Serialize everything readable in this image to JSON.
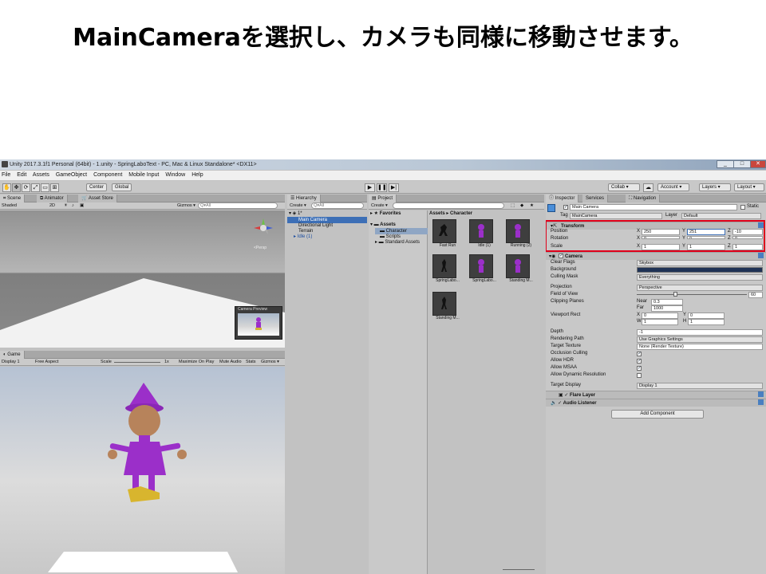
{
  "heading": "MainCameraを選択し、カメラも同様に移動させます。",
  "window": {
    "title": "Unity 2017.3.1f1 Personal (64bit) - 1.unity - SpringLaboText - PC, Mac & Linux Standalone* <DX11>",
    "controls": [
      "_",
      "□",
      "✕"
    ]
  },
  "menu": [
    "File",
    "Edit",
    "Assets",
    "GameObject",
    "Component",
    "Mobile Input",
    "Window",
    "Help"
  ],
  "toolbar": {
    "center": "Center",
    "global": "Global",
    "collab": "Collab ▾",
    "account": "Account ▾",
    "layers": "Layers ▾",
    "layout": "Layout ▾"
  },
  "scene": {
    "tabs": [
      "Scene",
      "Animator",
      "Asset Store"
    ],
    "shaded": "Shaded",
    "mode2d": "2D",
    "gizmos": "Gizmos ▾",
    "search_placeholder": "Q▾All",
    "persp": "<Persp",
    "camera_preview": "Camera Preview"
  },
  "game": {
    "tab": "Game",
    "display": "Display 1",
    "aspect": "Free Aspect",
    "scale_label": "Scale",
    "scale_value": "1x",
    "maximize": "Maximize On Play",
    "mute": "Mute Audio",
    "stats": "Stats",
    "gizmos": "Gizmos ▾"
  },
  "hierarchy": {
    "tab": "Hierarchy",
    "create": "Create ▾",
    "search_placeholder": "Q▾All",
    "scene": "1*",
    "items": [
      "Main Camera",
      "Directional Light",
      "Terrain",
      "Idle (1)"
    ]
  },
  "project": {
    "tab": "Project",
    "create": "Create ▾",
    "favorites": "Favorites",
    "assets": "Assets",
    "folders": [
      "Character",
      "Scripts",
      "Standard Assets"
    ],
    "breadcrumb": "Assets ▸ Character",
    "thumbs": [
      "Fast Run",
      "Idle (1)",
      "Running (2)",
      "SpringLabo...",
      "SpringLabo...",
      "Standing M...",
      "Standing M..."
    ]
  },
  "inspector": {
    "tabs": [
      "Inspector",
      "Services",
      "Navigation"
    ],
    "object_name": "Main Camera",
    "static_label": "Static",
    "tag_label": "Tag",
    "tag_value": "MainCamera",
    "layer_label": "Layer",
    "layer_value": "Default",
    "transform": {
      "title": "Transform",
      "position_label": "Position",
      "rotation_label": "Rotation",
      "scale_label": "Scale",
      "position": {
        "x": "250",
        "y": "251",
        "z": "-10"
      },
      "rotation": {
        "x": "0",
        "y": "0",
        "z": "0"
      },
      "scale": {
        "x": "1",
        "y": "1",
        "z": "1"
      }
    },
    "camera": {
      "title": "Camera",
      "rows": [
        {
          "label": "Clear Flags",
          "value": "Skybox"
        },
        {
          "label": "Background",
          "value": ""
        },
        {
          "label": "Culling Mask",
          "value": "Everything"
        },
        {
          "label": "Projection",
          "value": "Perspective"
        },
        {
          "label": "Field of View",
          "value": "60"
        },
        {
          "label": "Clipping Planes",
          "value": ""
        },
        {
          "label": "Viewport Rect",
          "value": ""
        },
        {
          "label": "Depth",
          "value": "-1"
        },
        {
          "label": "Rendering Path",
          "value": "Use Graphics Settings"
        },
        {
          "label": "Target Texture",
          "value": "None (Render Texture)"
        },
        {
          "label": "Occlusion Culling",
          "value": "✓"
        },
        {
          "label": "Allow HDR",
          "value": "✓"
        },
        {
          "label": "Allow MSAA",
          "value": "✓"
        },
        {
          "label": "Allow Dynamic Resolution",
          "value": ""
        },
        {
          "label": "Target Display",
          "value": "Display 1"
        }
      ],
      "near_label": "Near",
      "near": "0.3",
      "far_label": "Far",
      "far": "1000",
      "vp_x": "0",
      "vp_y": "0",
      "vp_w": "1",
      "vp_h": "1"
    },
    "flare": "Flare Layer",
    "audio": "Audio Listener",
    "add_component": "Add Component"
  },
  "colors": {
    "highlight": "#e0001a",
    "selection": "#3d6fb6",
    "character": "#9b2fc9"
  }
}
